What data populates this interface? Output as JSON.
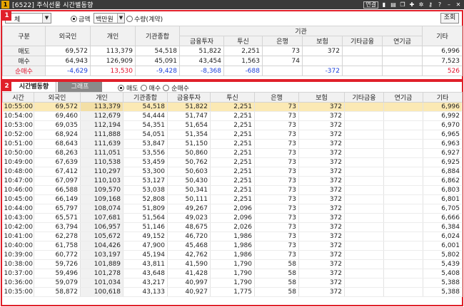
{
  "window": {
    "badge": "1",
    "title": "[6522] 주식선물 시간별동향",
    "link_label": "연결",
    "icons": [
      "save-icon",
      "print-icon",
      "copy-icon",
      "pin-icon",
      "settings-icon",
      "key-icon",
      "help-icon",
      "minimize-icon",
      "close-icon"
    ]
  },
  "panel1": {
    "badge": "1",
    "stock_combo": "체",
    "radio_amount": "금액",
    "unit_value": "백만원",
    "radio_qty": "수량(계약)",
    "search_button": "조회",
    "headers": {
      "gubun": "구분",
      "foreign": "외국인",
      "individual": "개인",
      "inst_total": "기관종합",
      "inst_group": "기관",
      "financial": "금융투자",
      "trust": "투신",
      "bank": "은행",
      "insurance": "보험",
      "other_fin": "기타금융",
      "pension": "연기금",
      "etc": "기타"
    },
    "rows": [
      {
        "label": "매도",
        "cells": [
          "69,572",
          "113,379",
          "54,518",
          "51,822",
          "2,251",
          "73",
          "372",
          "",
          "",
          "6,996"
        ]
      },
      {
        "label": "매수",
        "cells": [
          "64,943",
          "126,909",
          "45,091",
          "43,454",
          "1,563",
          "74",
          "",
          "",
          "",
          "7,523"
        ]
      },
      {
        "label": "순매수",
        "cells": [
          "-4,629",
          "13,530",
          "-9,428",
          "-8,368",
          "-688",
          "",
          "-372",
          "",
          "",
          "526"
        ]
      }
    ]
  },
  "panel2": {
    "badge": "2",
    "tab_active": "시간별동향",
    "tab_inactive": "그래프",
    "radio_sell": "매도",
    "radio_buy": "매수",
    "radio_net": "순매수",
    "headers": [
      "시간",
      "외국인",
      "개인",
      "기관종합",
      "금융투자",
      "투신",
      "은행",
      "보험",
      "기타금융",
      "연기금",
      "기타"
    ],
    "rows": [
      [
        "10:55:00",
        "69,572",
        "113,379",
        "54,518",
        "51,822",
        "2,251",
        "73",
        "372",
        "",
        "",
        "6,996"
      ],
      [
        "10:54:00",
        "69,460",
        "112,679",
        "54,444",
        "51,747",
        "2,251",
        "73",
        "372",
        "",
        "",
        "6,992"
      ],
      [
        "10:53:00",
        "69,035",
        "112,194",
        "54,351",
        "51,654",
        "2,251",
        "73",
        "372",
        "",
        "",
        "6,970"
      ],
      [
        "10:52:00",
        "68,924",
        "111,888",
        "54,051",
        "51,354",
        "2,251",
        "73",
        "372",
        "",
        "",
        "6,965"
      ],
      [
        "10:51:00",
        "68,643",
        "111,639",
        "53,847",
        "51,150",
        "2,251",
        "73",
        "372",
        "",
        "",
        "6,963"
      ],
      [
        "10:50:00",
        "68,263",
        "111,051",
        "53,556",
        "50,860",
        "2,251",
        "73",
        "372",
        "",
        "",
        "6,927"
      ],
      [
        "10:49:00",
        "67,639",
        "110,538",
        "53,459",
        "50,762",
        "2,251",
        "73",
        "372",
        "",
        "",
        "6,925"
      ],
      [
        "10:48:00",
        "67,412",
        "110,297",
        "53,300",
        "50,603",
        "2,251",
        "73",
        "372",
        "",
        "",
        "6,884"
      ],
      [
        "10:47:00",
        "67,097",
        "110,103",
        "53,127",
        "50,430",
        "2,251",
        "73",
        "372",
        "",
        "",
        "6,862"
      ],
      [
        "10:46:00",
        "66,588",
        "109,570",
        "53,038",
        "50,341",
        "2,251",
        "73",
        "372",
        "",
        "",
        "6,803"
      ],
      [
        "10:45:00",
        "66,149",
        "109,168",
        "52,808",
        "50,111",
        "2,251",
        "73",
        "372",
        "",
        "",
        "6,801"
      ],
      [
        "10:44:00",
        "65,797",
        "108,074",
        "51,809",
        "49,267",
        "2,096",
        "73",
        "372",
        "",
        "",
        "6,705"
      ],
      [
        "10:43:00",
        "65,571",
        "107,681",
        "51,564",
        "49,023",
        "2,096",
        "73",
        "372",
        "",
        "",
        "6,666"
      ],
      [
        "10:42:00",
        "63,794",
        "106,957",
        "51,146",
        "48,675",
        "2,026",
        "73",
        "372",
        "",
        "",
        "6,384"
      ],
      [
        "10:41:00",
        "62,278",
        "105,672",
        "49,152",
        "46,720",
        "1,986",
        "73",
        "372",
        "",
        "",
        "6,024"
      ],
      [
        "10:40:00",
        "61,758",
        "104,426",
        "47,900",
        "45,468",
        "1,986",
        "73",
        "372",
        "",
        "",
        "6,001"
      ],
      [
        "10:39:00",
        "60,772",
        "103,197",
        "45,194",
        "42,762",
        "1,986",
        "73",
        "372",
        "",
        "",
        "5,802"
      ],
      [
        "10:38:00",
        "59,726",
        "101,889",
        "43,811",
        "41,590",
        "1,790",
        "58",
        "372",
        "",
        "",
        "5,439"
      ],
      [
        "10:37:00",
        "59,496",
        "101,278",
        "43,648",
        "41,428",
        "1,790",
        "58",
        "372",
        "",
        "",
        "5,408"
      ],
      [
        "10:36:00",
        "59,079",
        "101,034",
        "43,217",
        "40,997",
        "1,790",
        "58",
        "372",
        "",
        "",
        "5,388"
      ],
      [
        "10:35:00",
        "58,872",
        "100,618",
        "43,133",
        "40,927",
        "1,775",
        "58",
        "372",
        "",
        "",
        "5,388"
      ]
    ]
  }
}
